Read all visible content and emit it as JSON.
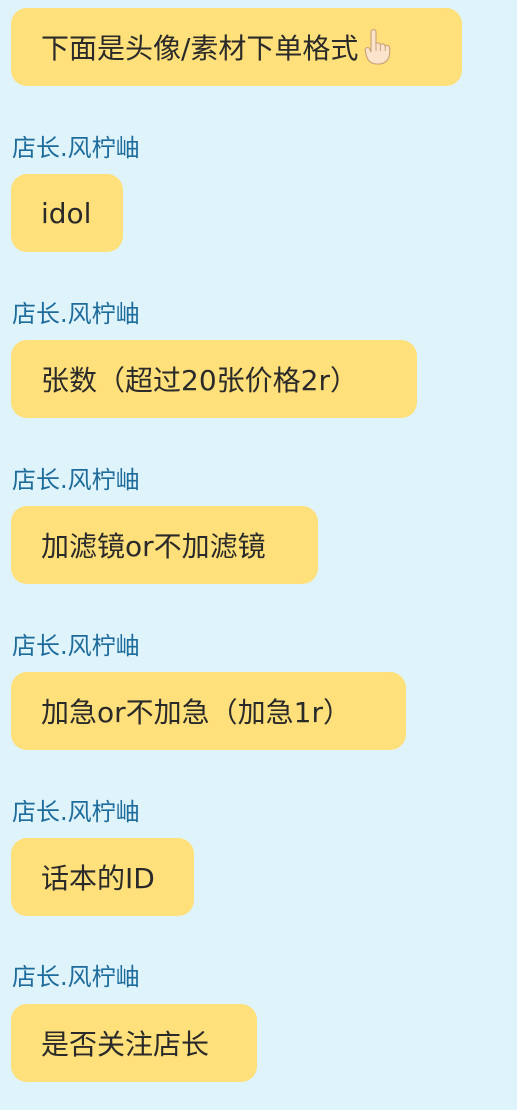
{
  "messages": [
    {
      "sender": "",
      "text": "下面是头像/素材下单格式",
      "emoji": "pointing-down-hand-icon"
    },
    {
      "sender": "店长.风柠岫",
      "text": "idol"
    },
    {
      "sender": "店长.风柠岫",
      "text": "张数（超过20张价格2r）"
    },
    {
      "sender": "店长.风柠岫",
      "text": "加滤镜or不加滤镜"
    },
    {
      "sender": "店长.风柠岫",
      "text": "加急or不加急（加急1r）"
    },
    {
      "sender": "店长.风柠岫",
      "text": "话本的ID"
    },
    {
      "sender": "店长.风柠岫",
      "text": "是否关注店长"
    }
  ],
  "colors": {
    "background": "#dff3fb",
    "bubble": "#ffe07a",
    "sender_name": "#1d6c9c",
    "text": "#2a2a2a"
  }
}
